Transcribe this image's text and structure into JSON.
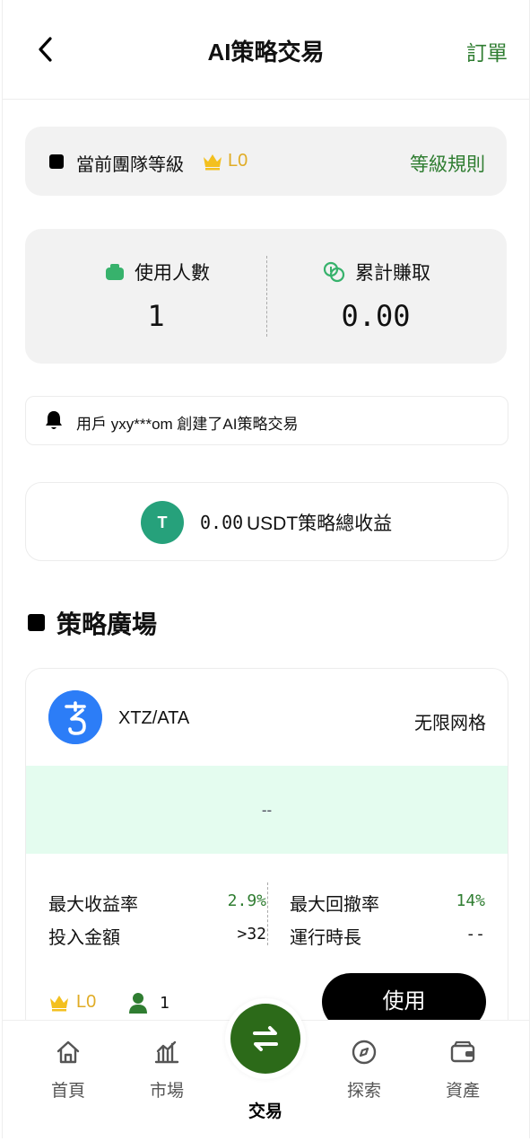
{
  "header": {
    "title": "AI策略交易",
    "orders_label": "訂單"
  },
  "level": {
    "label": "當前團隊等級",
    "value": "L0",
    "rules_label": "等級規則"
  },
  "stats": {
    "users_label": "使用人數",
    "users_value": "1",
    "earned_label": "累計賺取",
    "earned_value": "0.00"
  },
  "notice": {
    "text": "用戶 yxy***om 創建了AI策略交易"
  },
  "total": {
    "coin_letter": "T",
    "amount": "0.00",
    "label": "USDT策略總收益"
  },
  "section": {
    "title": "策略廣場"
  },
  "strategy": {
    "pair": "XTZ/ATA",
    "type": "无限网格",
    "chart_placeholder": "--",
    "max_return_label": "最大收益率",
    "max_return_value": "2.9%",
    "max_drawdown_label": "最大回撤率",
    "max_drawdown_value": "14%",
    "investment_label": "投入金額",
    "investment_value": ">32",
    "runtime_label": "運行時長",
    "runtime_value": "--",
    "level": "L0",
    "users": "1",
    "use_button": "使用"
  },
  "nav": {
    "items": [
      {
        "label": "首頁",
        "icon": "home-icon"
      },
      {
        "label": "市場",
        "icon": "market-chart-icon"
      },
      {
        "label": "交易",
        "icon": "swap-icon"
      },
      {
        "label": "探索",
        "icon": "compass-icon"
      },
      {
        "label": "資產",
        "icon": "wallet-icon"
      }
    ],
    "active": "交易"
  },
  "colors": {
    "accent_green": "#2f7d31",
    "gold": "#e0ac26",
    "fab_green": "#2c6a19",
    "usdt": "#26a17b",
    "xtz_blue": "#2c7df7"
  }
}
